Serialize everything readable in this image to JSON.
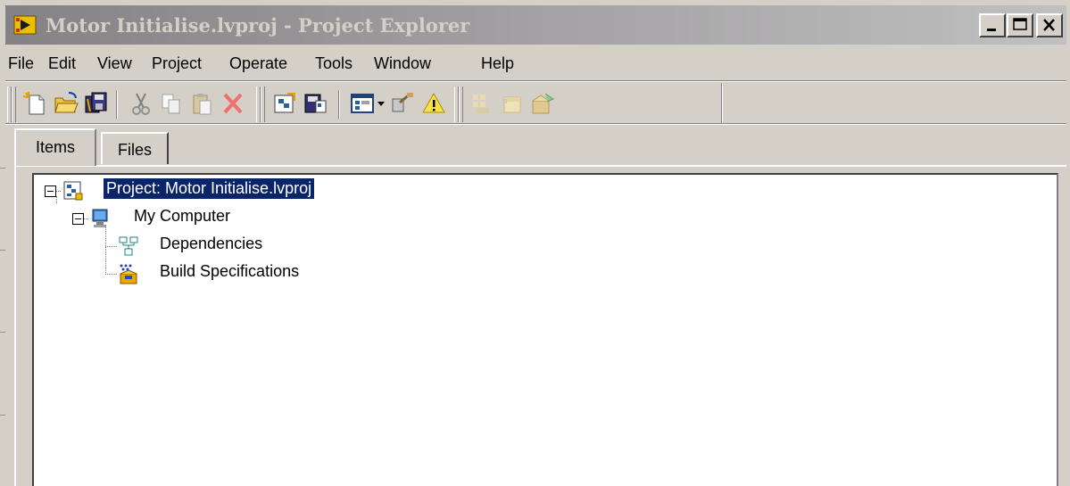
{
  "window": {
    "title": "Motor Initialise.lvproj - Project Explorer",
    "title_icon": "labview-project-icon",
    "controls": [
      "minimize",
      "maximize",
      "close"
    ]
  },
  "menu": {
    "items": [
      "File",
      "Edit",
      "View",
      "Project",
      "Operate",
      "Tools",
      "Window",
      "Help"
    ]
  },
  "toolbar": {
    "groups": [
      [
        "new-icon",
        "open-icon",
        "save-all-icon"
      ],
      [
        "cut-icon",
        "copy-icon",
        "paste-icon",
        "delete-icon"
      ],
      [
        "project-icon",
        "save-project-icon"
      ],
      [
        "view-icon",
        "tool-icon",
        "warning-icon"
      ],
      [
        "build-icon",
        "package-icon",
        "deploy-icon"
      ]
    ]
  },
  "tabs": {
    "items_label": "Items",
    "files_label": "Files",
    "active": "Items"
  },
  "tree": {
    "project_label": "Project: Motor Initialise.lvproj",
    "computer_label": "My Computer",
    "dependencies_label": "Dependencies",
    "build_label": "Build Specifications"
  },
  "colors": {
    "selection": "#0a246a",
    "face": "#d4d0c8"
  }
}
